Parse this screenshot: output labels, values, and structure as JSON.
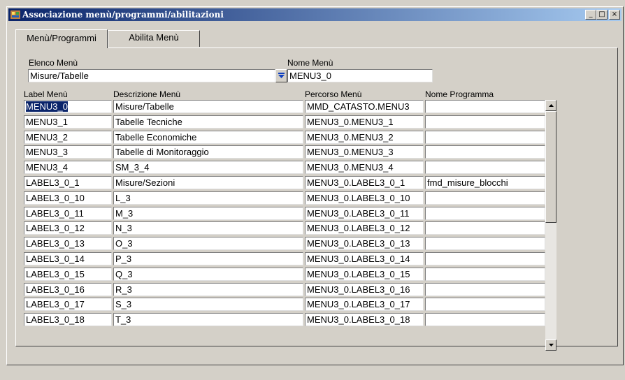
{
  "window": {
    "title": "Associazione menù/programmi/abilitazioni",
    "minimize_glyph": "_",
    "maximize_glyph": "□",
    "close_glyph": "×"
  },
  "tabs": [
    {
      "label": "Menù/Programmi",
      "active": true
    },
    {
      "label": "Abilita Menù",
      "active": false
    }
  ],
  "form": {
    "elenco_menu_label": "Elenco Menù",
    "elenco_menu_value": "Misure/Tabelle",
    "nome_menu_label": "Nome Menù",
    "nome_menu_value": "MENU3_0"
  },
  "grid": {
    "headers": [
      "Label Menù",
      "Descrizione Menù",
      "Percorso Menù",
      "Nome Programma"
    ],
    "rows": [
      [
        "MENU3_0",
        "Misure/Tabelle",
        "MMD_CATASTO.MENU3",
        ""
      ],
      [
        "MENU3_1",
        "Tabelle Tecniche",
        "MENU3_0.MENU3_1",
        ""
      ],
      [
        "MENU3_2",
        "Tabelle Economiche",
        "MENU3_0.MENU3_2",
        ""
      ],
      [
        "MENU3_3",
        "Tabelle di Monitoraggio",
        "MENU3_0.MENU3_3",
        ""
      ],
      [
        "MENU3_4",
        "SM_3_4",
        "MENU3_0.MENU3_4",
        ""
      ],
      [
        "LABEL3_0_1",
        "Misure/Sezioni",
        "MENU3_0.LABEL3_0_1",
        "fmd_misure_blocchi"
      ],
      [
        "LABEL3_0_10",
        "L_3",
        "MENU3_0.LABEL3_0_10",
        ""
      ],
      [
        "LABEL3_0_11",
        "M_3",
        "MENU3_0.LABEL3_0_11",
        ""
      ],
      [
        "LABEL3_0_12",
        "N_3",
        "MENU3_0.LABEL3_0_12",
        ""
      ],
      [
        "LABEL3_0_13",
        "O_3",
        "MENU3_0.LABEL3_0_13",
        ""
      ],
      [
        "LABEL3_0_14",
        "P_3",
        "MENU3_0.LABEL3_0_14",
        ""
      ],
      [
        "LABEL3_0_15",
        "Q_3",
        "MENU3_0.LABEL3_0_15",
        ""
      ],
      [
        "LABEL3_0_16",
        "R_3",
        "MENU3_0.LABEL3_0_16",
        ""
      ],
      [
        "LABEL3_0_17",
        "S_3",
        "MENU3_0.LABEL3_0_17",
        ""
      ],
      [
        "LABEL3_0_18",
        "T_3",
        "MENU3_0.LABEL3_0_18",
        ""
      ]
    ],
    "selected_row": 0
  },
  "colors": {
    "face": "#d4d0c8",
    "title_start": "#0a246a",
    "title_end": "#a6caf0",
    "selection": "#0a246a",
    "dropdown_arrow": "#1040c0"
  }
}
